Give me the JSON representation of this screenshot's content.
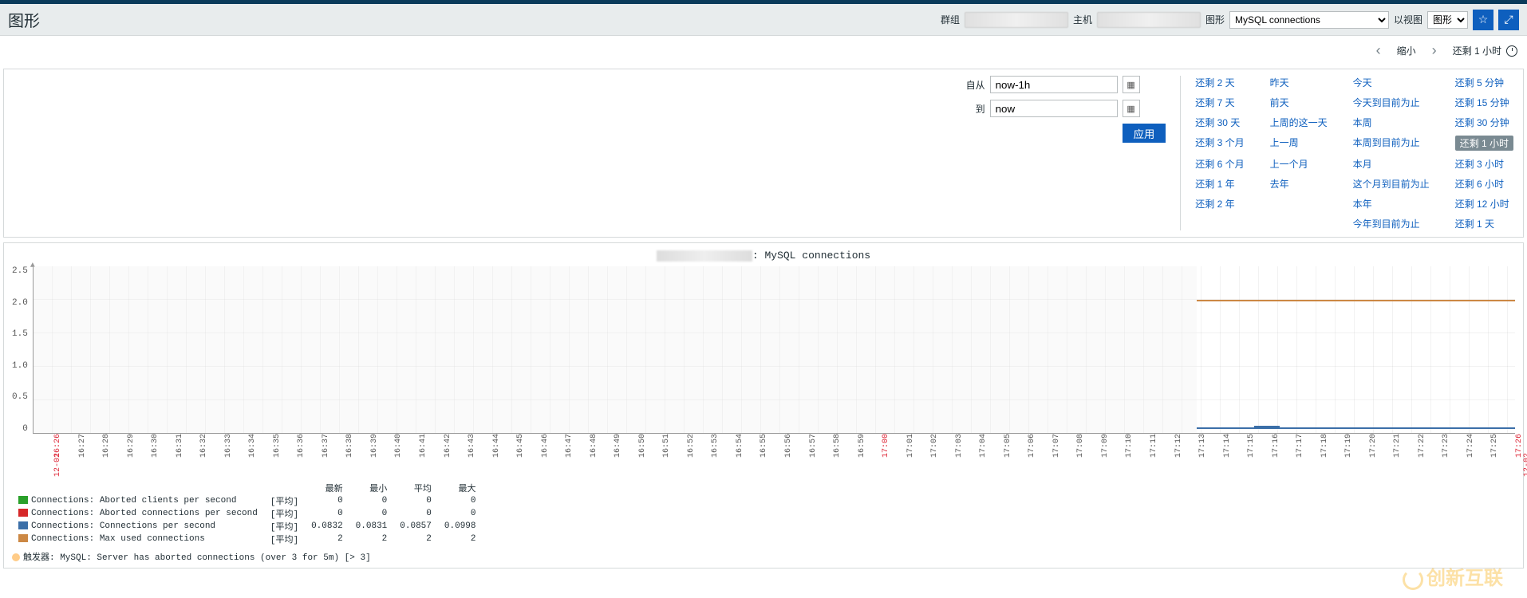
{
  "header": {
    "page_title": "图形",
    "group_label": "群组",
    "host_label": "主机",
    "graph_label": "图形",
    "graph_select": "MySQL connections",
    "view_label": "以视图",
    "view_select": "图形"
  },
  "time_nav": {
    "zoom_out": "缩小",
    "current": "还剩 1 小时"
  },
  "time_panel": {
    "from_label": "自从",
    "from_value": "now-1h",
    "to_label": "到",
    "to_value": "now",
    "apply": "应用"
  },
  "quick_ranges": {
    "col1": [
      "还剩 2 天",
      "还剩 7 天",
      "还剩 30 天",
      "还剩 3 个月",
      "还剩 6 个月",
      "还剩 1 年",
      "还剩 2 年"
    ],
    "col2": [
      "昨天",
      "前天",
      "上周的这一天",
      "上一周",
      "上一个月",
      "去年",
      ""
    ],
    "col3": [
      "今天",
      "今天到目前为止",
      "本周",
      "本周到目前为止",
      "本月",
      "这个月到目前为止",
      "本年",
      "今年到目前为止"
    ],
    "col4": [
      "还剩 5 分钟",
      "还剩 15 分钟",
      "还剩 30 分钟",
      "还剩 1 小时",
      "还剩 3 小时",
      "还剩 6 小时",
      "还剩 12 小时",
      "还剩 1 天"
    ]
  },
  "chart_data": {
    "type": "line",
    "title_suffix": ": MySQL connections",
    "ylim": [
      0,
      2.5
    ],
    "y_ticks": [
      "2.5",
      "2.0",
      "1.5",
      "1.0",
      "0.5",
      "0"
    ],
    "x_date": "12-02",
    "x_ticks": [
      "16:26",
      "16:27",
      "16:28",
      "16:29",
      "16:30",
      "16:31",
      "16:32",
      "16:33",
      "16:34",
      "16:35",
      "16:36",
      "16:37",
      "16:38",
      "16:39",
      "16:40",
      "16:41",
      "16:42",
      "16:43",
      "16:44",
      "16:45",
      "16:46",
      "16:47",
      "16:48",
      "16:49",
      "16:50",
      "16:51",
      "16:52",
      "16:53",
      "16:54",
      "16:55",
      "16:56",
      "16:57",
      "16:58",
      "16:59",
      "17:00",
      "17:01",
      "17:02",
      "17:03",
      "17:04",
      "17:05",
      "17:06",
      "17:07",
      "17:08",
      "17:09",
      "17:10",
      "17:11",
      "17:12",
      "17:13",
      "17:14",
      "17:15",
      "17:16",
      "17:17",
      "17:18",
      "17:19",
      "17:20",
      "17:21",
      "17:22",
      "17:23",
      "17:24",
      "17:25",
      "17:26"
    ],
    "x_red": [
      "16:26",
      "17:00",
      "17:26"
    ],
    "series": [
      {
        "name": "Connections: Aborted clients per second",
        "agg": "[平均]",
        "color": "#2aa02a",
        "latest": "0",
        "min": "0",
        "avg": "0",
        "max": "0"
      },
      {
        "name": "Connections: Aborted connections per second",
        "agg": "[平均]",
        "color": "#d62728",
        "latest": "0",
        "min": "0",
        "avg": "0",
        "max": "0"
      },
      {
        "name": "Connections: Connections per second",
        "agg": "[平均]",
        "color": "#3b6fa8",
        "latest": "0.0832",
        "min": "0.0831",
        "avg": "0.0857",
        "max": "0.0998"
      },
      {
        "name": "Connections: Max used connections",
        "agg": "[平均]",
        "color": "#cc8844",
        "latest": "2",
        "min": "2",
        "avg": "2",
        "max": "2"
      }
    ],
    "legend_headers": {
      "latest": "最新",
      "min": "最小",
      "avg": "平均",
      "max": "最大"
    },
    "trigger": "触发器: MySQL: Server has aborted connections (over 3 for 5m)   [> 3]"
  },
  "watermark": "创新互联"
}
